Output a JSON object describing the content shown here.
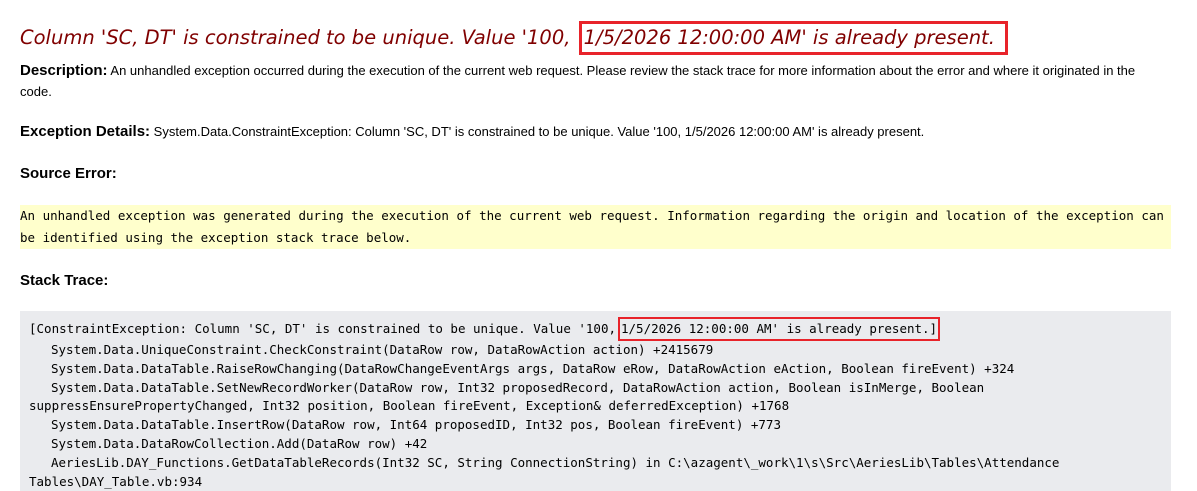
{
  "error": {
    "title_prefix": "Column 'SC, DT' is constrained to be unique.  Value '100,",
    "title_highlight": "1/5/2026 12:00:00 AM' is already present.",
    "highlight_color": "#e8232a",
    "title_color": "#800000"
  },
  "description": {
    "label": "Description:",
    "text": "An unhandled exception occurred during the execution of the current web request. Please review the stack trace for more information about the error and where it originated in the code."
  },
  "exception_details": {
    "label": "Exception Details:",
    "text": "System.Data.ConstraintException: Column 'SC, DT' is constrained to be unique.  Value '100, 1/5/2026 12:00:00 AM' is already present."
  },
  "source_error": {
    "heading": "Source Error:",
    "text": "An unhandled exception was generated during the execution of the current web request. Information regarding the origin and location of the exception can be identified using the exception stack trace below.",
    "background": "#ffffcc"
  },
  "stack_trace": {
    "heading": "Stack Trace:",
    "background": "#eaebee",
    "first_line_prefix": "[ConstraintException: Column 'SC, DT' is constrained to be unique.  Value '100,",
    "first_line_highlight": "1/5/2026 12:00:00 AM' is already present.]",
    "lines": [
      "   System.Data.UniqueConstraint.CheckConstraint(DataRow row, DataRowAction action) +2415679",
      "   System.Data.DataTable.RaiseRowChanging(DataRowChangeEventArgs args, DataRow eRow, DataRowAction eAction, Boolean fireEvent) +324",
      "   System.Data.DataTable.SetNewRecordWorker(DataRow row, Int32 proposedRecord, DataRowAction action, Boolean isInMerge, Boolean suppressEnsurePropertyChanged, Int32 position, Boolean fireEvent, Exception& deferredException) +1768",
      "   System.Data.DataTable.InsertRow(DataRow row, Int64 proposedID, Int32 pos, Boolean fireEvent) +773",
      "   System.Data.DataRowCollection.Add(DataRow row) +42",
      "   AeriesLib.DAY_Functions.GetDataTableRecords(Int32 SC, String ConnectionString) in C:\\azagent\\_work\\1\\s\\Src\\AeriesLib\\Tables\\Attendance Tables\\DAY_Table.vb:934"
    ]
  }
}
